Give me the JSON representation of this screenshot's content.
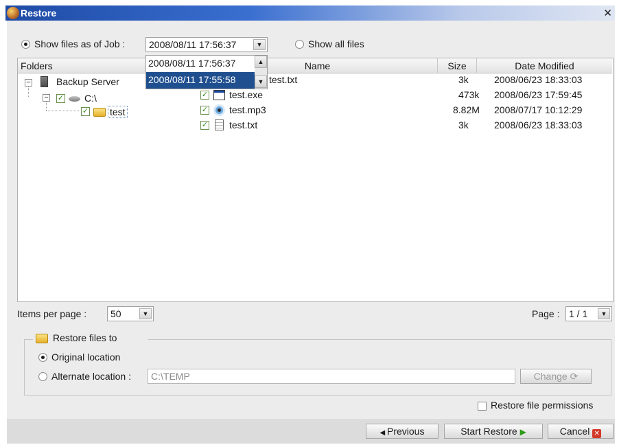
{
  "window": {
    "title": "Restore",
    "close_glyph": "✕"
  },
  "job": {
    "show_by_job_label": "Show files as of Job :",
    "show_by_job_selected": true,
    "selected_job": "2008/08/11 17:56:37",
    "dropdown_options": [
      "2008/08/11 17:56:37",
      "2008/08/11 17:55:58"
    ],
    "highlighted_option": "2008/08/11 17:55:58",
    "show_all_label": "Show all files",
    "show_all_selected": false
  },
  "folders": {
    "header": "Folders",
    "root": "Backup Server",
    "drive": "C:\\",
    "folder": "test"
  },
  "files": {
    "columns": {
      "name": "Name",
      "size": "Size",
      "modified": "Date Modified"
    },
    "rows": [
      {
        "name": "test.txt",
        "size": "3k",
        "modified": "2008/06/23 18:33:03",
        "icon": "text-file-icon"
      },
      {
        "name": "test.exe",
        "size": "473k",
        "modified": "2008/06/23 17:59:45",
        "icon": "executable-icon"
      },
      {
        "name": "test.mp3",
        "size": "8.82M",
        "modified": "2008/07/17 10:12:29",
        "icon": "media-file-icon"
      },
      {
        "name": "test.txt",
        "size": "3k",
        "modified": "2008/06/23 18:33:03",
        "icon": "text-file-icon"
      }
    ]
  },
  "paging": {
    "items_per_page_label": "Items per page :",
    "items_per_page": "50",
    "page_label": "Page :",
    "page_value": "1 / 1"
  },
  "restore_to": {
    "section_title": "Restore files to",
    "original_label": "Original location",
    "original_selected": true,
    "alternate_label": "Alternate location :",
    "alternate_selected": false,
    "alternate_path": "C:\\TEMP",
    "change_label": "Change"
  },
  "permissions": {
    "label": "Restore file permissions",
    "checked": false
  },
  "buttons": {
    "previous": "Previous",
    "start": "Start Restore",
    "cancel": "Cancel"
  },
  "colors": {
    "title_start": "#1d4aa5",
    "selection": "#1f4f8f",
    "check_green": "#2a8a16",
    "cancel_red": "#d23a2a"
  }
}
